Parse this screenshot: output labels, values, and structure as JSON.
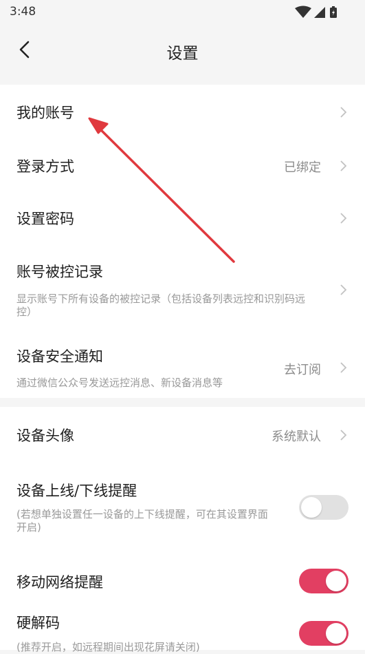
{
  "status_bar": {
    "time": "3:48"
  },
  "header": {
    "title": "设置"
  },
  "group1": {
    "my_account": {
      "title": "我的账号"
    },
    "login_method": {
      "title": "登录方式",
      "value": "已绑定"
    },
    "set_password": {
      "title": "设置密码"
    },
    "control_record": {
      "title": "账号被控记录",
      "subtitle": "显示账号下所有设备的被控记录（包括设备列表远控和识别码远控）"
    },
    "security_notice": {
      "title": "设备安全通知",
      "subtitle": "通过微信公众号发送远控消息、新设备消息等",
      "value": "去订阅"
    }
  },
  "group2": {
    "avatar": {
      "title": "设备头像",
      "value": "系统默认"
    },
    "online_alert": {
      "title": "设备上线/下线提醒",
      "subtitle": "(若想单独设置任一设备的上下线提醒，可在其设置界面开启)",
      "enabled": false
    },
    "mobile_alert": {
      "title": "移动网络提醒",
      "enabled": true
    },
    "hard_decode": {
      "title": "硬解码",
      "subtitle": "(推荐开启，如远程期间出现花屏请关闭)",
      "enabled": true
    }
  },
  "colors": {
    "accent": "#e23f62",
    "annotation_arrow": "#e0393e"
  }
}
